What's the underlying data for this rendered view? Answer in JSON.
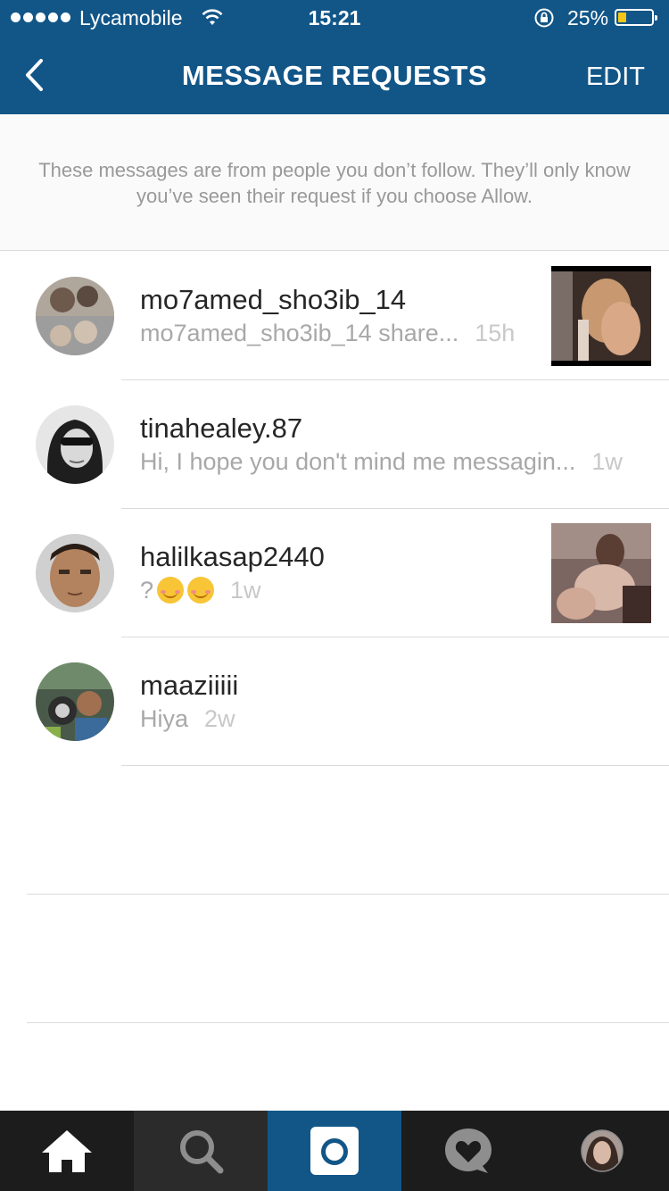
{
  "status_bar": {
    "carrier": "Lycamobile",
    "time": "15:21",
    "battery_percent": "25%",
    "battery_level": 0.25
  },
  "header": {
    "back_icon": "chevron-left-icon",
    "title": "MESSAGE REQUESTS",
    "edit_label": "EDIT",
    "background_color": "#125688"
  },
  "info": {
    "text": "These messages are from people you don’t follow. They’ll only know you’ve seen their request if you choose Allow."
  },
  "requests": [
    {
      "username": "mo7amed_sho3ib_14",
      "preview": "mo7amed_sho3ib_14 share...",
      "time": "15h",
      "has_thumbnail": true
    },
    {
      "username": "tinahealey.87",
      "preview": "Hi, I hope you don't mind me messagin...",
      "time": "1w",
      "has_thumbnail": false
    },
    {
      "username": "halilkasap2440",
      "preview": "?",
      "time": "1w",
      "emoji_count": 2,
      "has_thumbnail": true
    },
    {
      "username": "maaziiiii",
      "preview": "Hiya",
      "time": "2w",
      "has_thumbnail": false
    }
  ],
  "tabbar": {
    "tabs": [
      "home-icon",
      "search-icon",
      "camera-icon",
      "activity-heart-icon",
      "profile-avatar"
    ],
    "active": "home-icon",
    "camera_color": "#125688"
  }
}
